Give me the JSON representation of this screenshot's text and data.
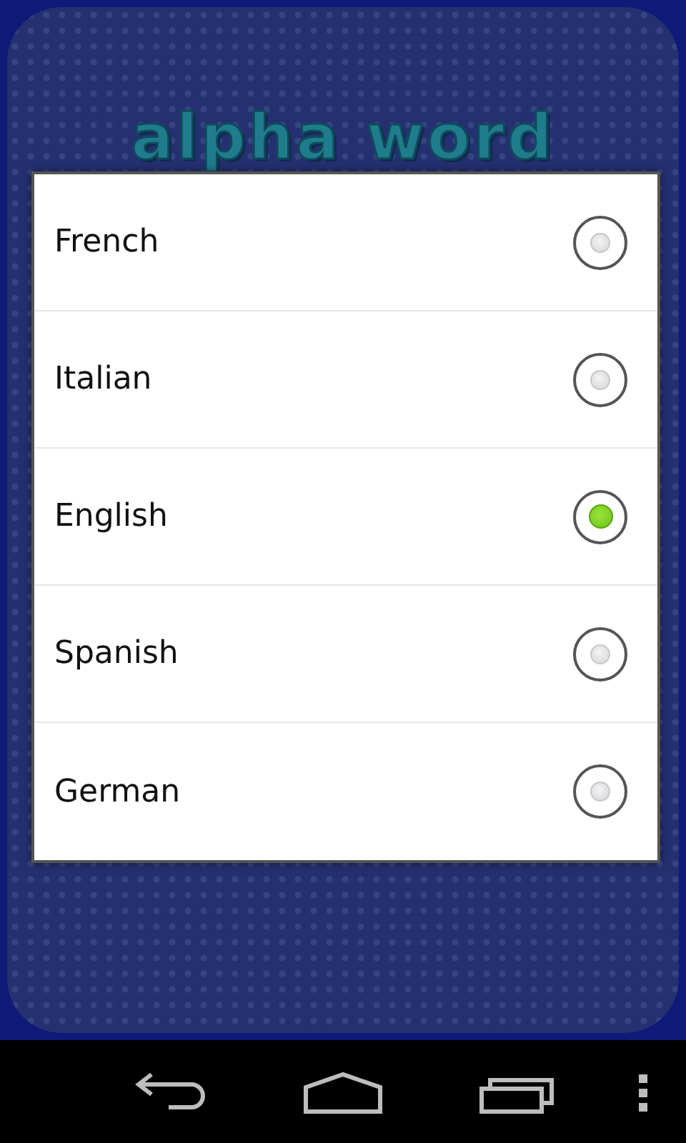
{
  "logo": "alpha word",
  "languages": [
    {
      "label": "French",
      "selected": false
    },
    {
      "label": "Italian",
      "selected": false
    },
    {
      "label": "English",
      "selected": true
    },
    {
      "label": "Spanish",
      "selected": false
    },
    {
      "label": "German",
      "selected": false
    }
  ]
}
